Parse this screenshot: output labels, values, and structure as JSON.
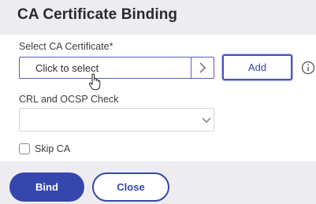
{
  "header": {
    "title": "CA Certificate Binding"
  },
  "ca_certificate": {
    "label": "Select CA Certificate*",
    "select_text": "Click to select",
    "add_label": "Add",
    "info_icon": "info-icon",
    "chevron_icon": "chevron-right-icon"
  },
  "crl_ocsp": {
    "label": "CRL and OCSP Check",
    "value": "",
    "chevron_icon": "chevron-down-icon"
  },
  "skip_ca": {
    "label": "Skip CA",
    "checked": false
  },
  "footer": {
    "bind_label": "Bind",
    "close_label": "Close"
  },
  "colors": {
    "primary": "#3547ad",
    "header_bg": "#ededf1",
    "border_active": "#5a5fb7"
  },
  "cursor": {
    "type": "hand-pointer"
  }
}
